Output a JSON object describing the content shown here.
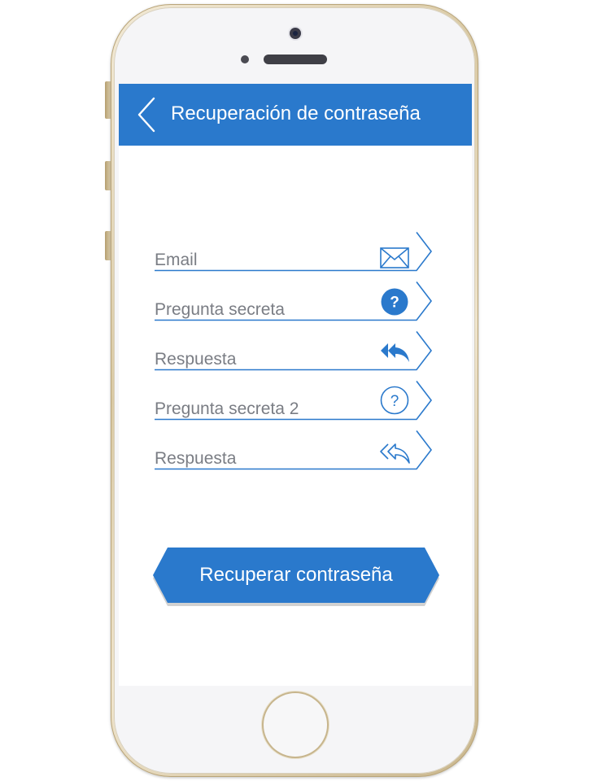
{
  "header": {
    "title": "Recuperación de contraseña",
    "back_icon": "chevron-left-icon"
  },
  "form": {
    "fields": [
      {
        "label": "Email",
        "icon": "envelope-icon"
      },
      {
        "label": "Pregunta secreta",
        "icon": "question-circle-filled-icon"
      },
      {
        "label": "Respuesta",
        "icon": "reply-all-filled-icon"
      },
      {
        "label": "Pregunta secreta 2",
        "icon": "question-circle-outline-icon"
      },
      {
        "label": "Respuesta",
        "icon": "reply-all-outline-icon"
      }
    ]
  },
  "actions": {
    "recover_label": "Recuperar contraseña"
  },
  "colors": {
    "primary": "#2a79cc",
    "label_gray": "#7a7d84",
    "header_text": "#ffffff"
  }
}
